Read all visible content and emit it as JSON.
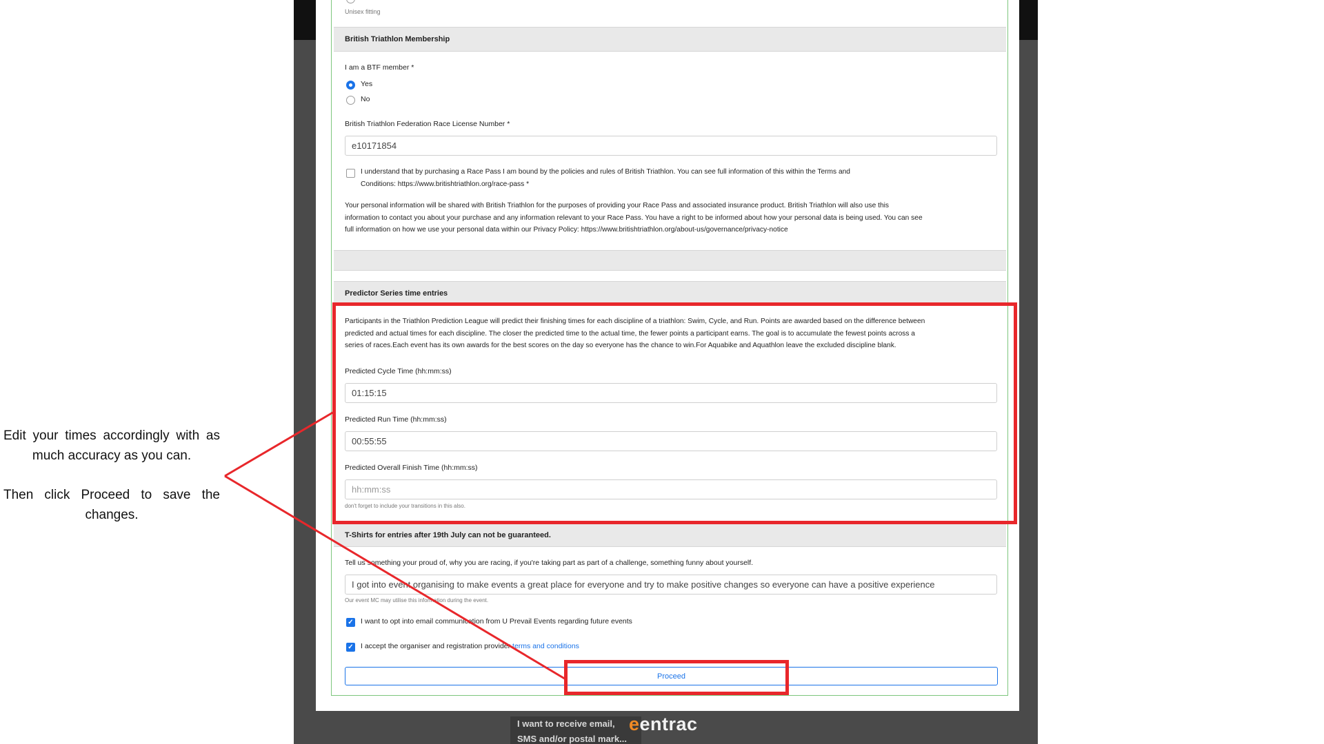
{
  "window": {
    "logo_prefix": "e",
    "logo_rest": "entrac",
    "background_snippet_1": "I want to receive email,",
    "background_snippet_2": "SMS and/or postal mark..."
  },
  "top": {
    "fitting_note": "Unisex fitting"
  },
  "membership": {
    "header": "British Triathlon Membership",
    "question": "I am a BTF member *",
    "options": [
      "Yes",
      "No"
    ],
    "selected": "Yes",
    "license_label": "British Triathlon Federation Race License Number *",
    "license_value": "e10171854",
    "agree_line1": "I understand that by purchasing a Race Pass I am bound by the policies and rules of British Triathlon. You can see full information of this within the Terms and",
    "agree_line2": "Conditions: https://www.britishtriathlon.org/race-pass *",
    "privacy_line1": "Your personal information will be shared with British Triathlon for the purposes of providing your Race Pass and associated insurance product. British Triathlon will also use this",
    "privacy_line2": "information to contact you about your purchase and any information relevant to your Race Pass. You have a right to be informed about how your personal data is being used. You can see",
    "privacy_line3": "full information on how we use your personal data within our Privacy Policy: https://www.britishtriathlon.org/about-us/governance/privacy-notice"
  },
  "predictor": {
    "header": "Predictor Series time entries",
    "desc_line1": "Participants in the Triathlon Prediction League will predict their finishing times for each discipline of a triathlon: Swim, Cycle, and Run. Points are awarded based on the difference between",
    "desc_line2": "predicted and actual times for each discipline. The closer the predicted time to the actual time, the fewer points a participant earns. The goal is to accumulate the fewest points across a",
    "desc_line3": "series of races.Each event has its own awards for the best scores on the day so everyone has the chance to win.For Aquabike and Aquathlon leave the excluded discipline blank.",
    "cycle_label": "Predicted Cycle Time (hh:mm:ss)",
    "cycle_value": "01:15:15",
    "run_label": "Predicted Run Time (hh:mm:ss)",
    "run_value": "00:55:55",
    "overall_label": "Predicted Overall Finish Time (hh:mm:ss)",
    "overall_placeholder": "hh:mm:ss",
    "overall_hint": "don't forget to include your transitions in this also."
  },
  "tshirts": {
    "header": "T-Shirts for entries after 19th July can not be guaranteed.",
    "about_label": "Tell us something your proud of, why you are racing, if you're taking part as part of a challenge, something funny about yourself.",
    "about_value": "I got into event organising to make events a great place for everyone and try to make positive changes so everyone can have a positive experience",
    "about_hint": "Our event MC may utilise this information during the event.",
    "optin_label": "I want to opt into email communication from U Prevail Events regarding future events",
    "accept_label": "I accept the organiser and registration provider ",
    "accept_link": "terms and conditions",
    "proceed_label": "Proceed"
  },
  "annotation": {
    "line1": "Edit your times accordingly with as much accuracy as you can.",
    "line2": "Then click Proceed to save the changes.",
    "highlight_color": "#e8272b"
  }
}
